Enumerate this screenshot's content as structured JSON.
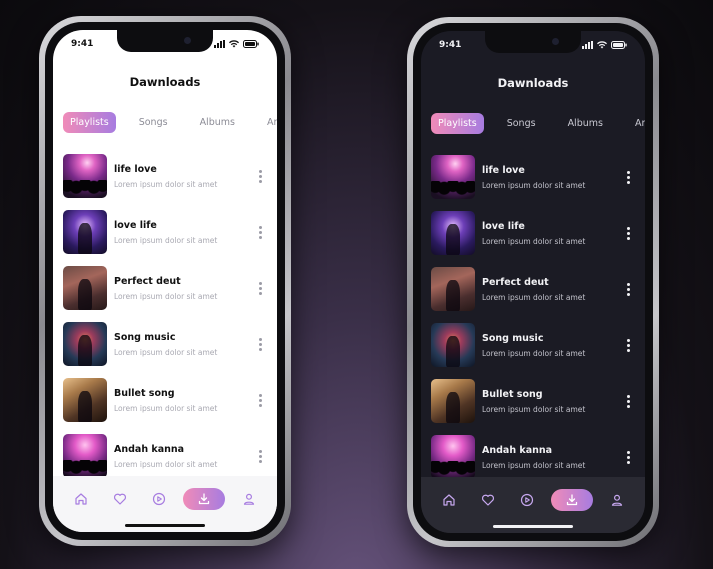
{
  "status": {
    "time": "9:41"
  },
  "header": {
    "title": "Dawnloads"
  },
  "tabs": [
    {
      "label": "Playlists",
      "active": true
    },
    {
      "label": "Songs",
      "active": false
    },
    {
      "label": "Albums",
      "active": false
    },
    {
      "label": "Artists",
      "active": false
    }
  ],
  "songs": [
    {
      "title": "life love",
      "subtitle": "Lorem ipsum dolor sit amet",
      "thumb": "concert-crowd"
    },
    {
      "title": "love life",
      "subtitle": "Lorem ipsum dolor sit amet",
      "thumb": "singer-microphone"
    },
    {
      "title": "Perfect deut",
      "subtitle": "Lorem ipsum dolor sit amet",
      "thumb": "guitarist"
    },
    {
      "title": "Song music",
      "subtitle": "Lorem ipsum dolor sit amet",
      "thumb": "singer-portrait"
    },
    {
      "title": "Bullet song",
      "subtitle": "Lorem ipsum dolor sit amet",
      "thumb": "guitar-performer"
    },
    {
      "title": "Andah kanna",
      "subtitle": "Lorem ipsum dolor sit amet",
      "thumb": "party-crowd"
    }
  ],
  "navbar": {
    "items": [
      {
        "icon": "home-icon",
        "active": false
      },
      {
        "icon": "heart-icon",
        "active": false
      },
      {
        "icon": "play-circle-icon",
        "active": false
      },
      {
        "icon": "download-icon",
        "active": true
      },
      {
        "icon": "user-icon",
        "active": false
      }
    ]
  },
  "colors": {
    "accent_start": "#f08bb8",
    "accent_end": "#a77ce0",
    "light_bg": "#ffffff",
    "dark_bg": "#1b1b24"
  }
}
